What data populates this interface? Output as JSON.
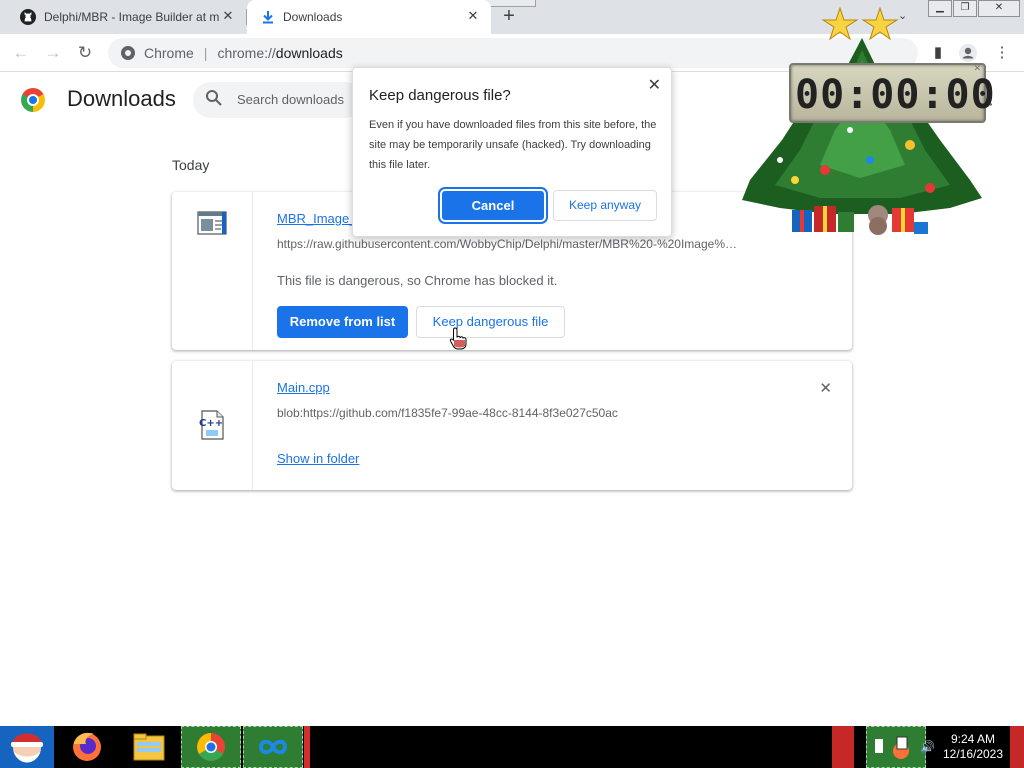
{
  "tabs": [
    {
      "title": "Delphi/MBR - Image Builder at m",
      "close": "✕"
    },
    {
      "title": "Downloads",
      "close": "✕"
    }
  ],
  "newtab": "+",
  "omnibox": {
    "scheme_label": "Chrome",
    "separator": "|",
    "url_prefix": "chrome://",
    "url_main": "downloads"
  },
  "page": {
    "title": "Downloads",
    "search_placeholder": "Search downloads",
    "section": "Today"
  },
  "downloads": [
    {
      "name": "MBR_Image_",
      "url": "https://raw.githubusercontent.com/WobbyChip/Delphi/master/MBR%20-%20Image%…",
      "status": "This file is dangerous, so Chrome has blocked it.",
      "primary_action": "Remove from list",
      "secondary_action": "Keep dangerous file"
    },
    {
      "name": "Main.cpp",
      "url": "blob:https://github.com/f1835fe7-99ae-48cc-8144-8f3e027c50ac",
      "link_action": "Show in folder",
      "close": "✕",
      "icon_label": "C++"
    }
  ],
  "dialog": {
    "title": "Keep dangerous file?",
    "body": "Even if you have downloaded files from this site before, the site may be temporarily unsafe (hacked). Try downloading this file later.",
    "cancel": "Cancel",
    "keep": "Keep anyway",
    "close": "✕"
  },
  "widget": {
    "clock": "00:00:00"
  },
  "taskbar": {
    "time": "9:24 AM",
    "date": "12/16/2023"
  },
  "colors": {
    "accent": "#1a73e8",
    "taskbar": "#000000",
    "tabstrip": "#dee1e6"
  }
}
